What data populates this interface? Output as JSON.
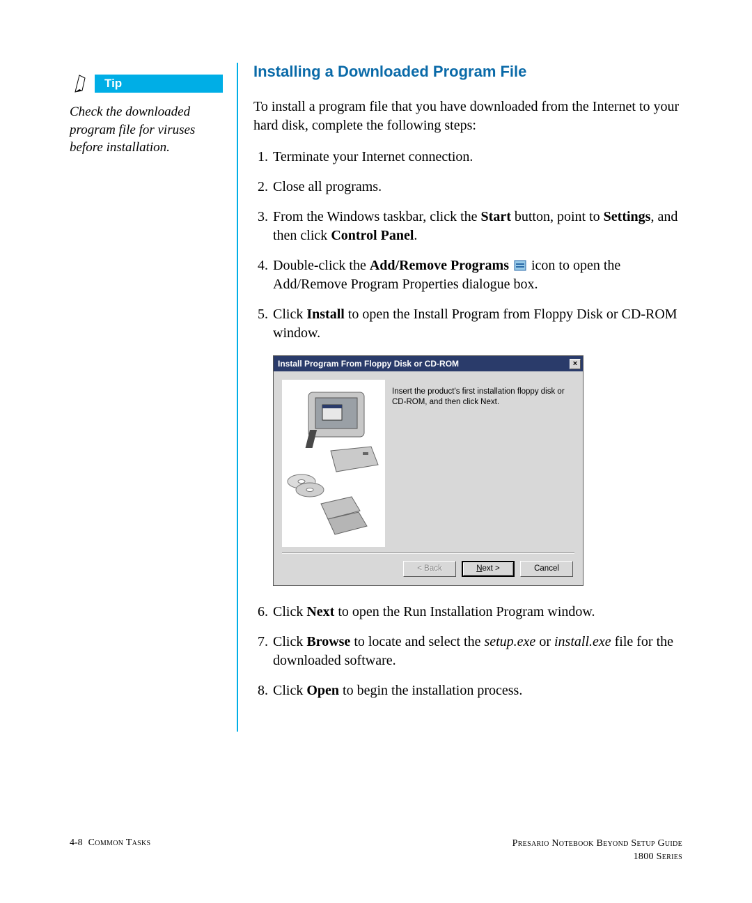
{
  "tip": {
    "label": "Tip",
    "text": "Check the downloaded program file for viruses before installation."
  },
  "title": "Installing a Downloaded Program File",
  "intro": "To install a program file that you have downloaded from the Internet to your hard disk, complete the following steps:",
  "steps": {
    "s1": "Terminate your Internet connection.",
    "s2": "Close all programs.",
    "s3a": "From the Windows taskbar, click the ",
    "s3b": "Start",
    "s3c": " button, point to ",
    "s3d": "Settings",
    "s3e": ", and then click ",
    "s3f": "Control Panel",
    "s3g": ".",
    "s4a": "Double-click the ",
    "s4b": "Add/Remove Programs",
    "s4c": " icon to open the Add/Remove Program Properties dialogue box.",
    "s5a": "Click ",
    "s5b": "Install",
    "s5c": " to open the Install Program from Floppy Disk or CD-ROM window.",
    "s6a": "Click ",
    "s6b": "Next",
    "s6c": " to open the Run Installation Program window.",
    "s7a": "Click ",
    "s7b": "Browse",
    "s7c": " to locate and select the ",
    "s7d": "setup.exe",
    "s7e": " or ",
    "s7f": "install.exe",
    "s7g": " file for the downloaded software.",
    "s8a": "Click ",
    "s8b": "Open",
    "s8c": " to begin the installation process."
  },
  "dialog": {
    "title": "Install Program From Floppy Disk or CD-ROM",
    "body": "Insert the product's first installation floppy disk or CD-ROM, and then click Next.",
    "back": "< Back",
    "next_u": "N",
    "next_rest": "ext >",
    "cancel": "Cancel"
  },
  "footer": {
    "page": "4-8",
    "section": "Common Tasks",
    "guide_l1": "Presario Notebook Beyond Setup Guide",
    "guide_l2": "1800 Series"
  }
}
